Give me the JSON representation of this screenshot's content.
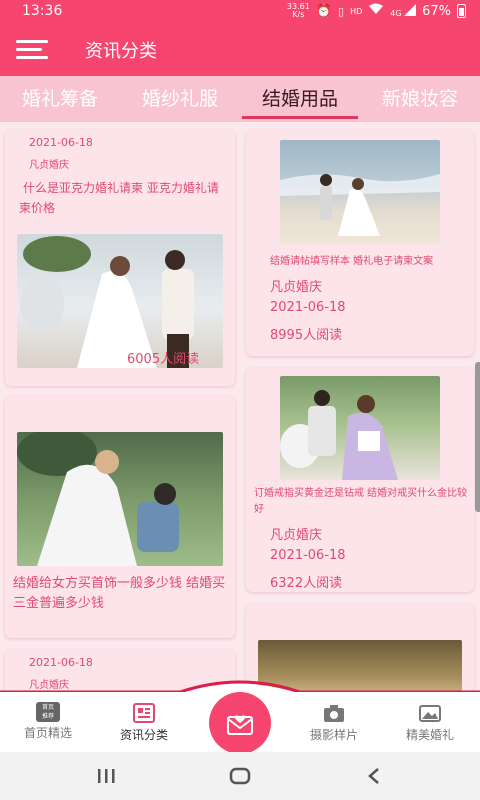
{
  "status_bar": {
    "time": "13:36",
    "net_speed_value": "33.61",
    "net_speed_unit": "K/s",
    "hd": "HD",
    "signal": "4G",
    "battery": "67%"
  },
  "header": {
    "title": "资讯分类"
  },
  "tabs": [
    {
      "label": "婚礼筹备",
      "active": false
    },
    {
      "label": "婚纱礼服",
      "active": false
    },
    {
      "label": "结婚用品",
      "active": true
    },
    {
      "label": "新娘妆容",
      "active": false
    }
  ],
  "cards": [
    {
      "date": "2021-06-18",
      "author": "凡贞婚庆",
      "title": "什么是亚克力婚礼请柬 亚克力婚礼请柬价格",
      "reads": "6005人阅读"
    },
    {
      "title": "结婚请帖填写样本 婚礼电子请柬文案",
      "author": "凡贞婚庆",
      "date": "2021-06-18",
      "reads": "8995人阅读"
    },
    {
      "title": "结婚给女方买首饰一般多少钱 结婚买三金普遍多少钱"
    },
    {
      "title": "订婚戒指买黄金还是钻戒 结婚对戒买什么金比较好",
      "author": "凡贞婚庆",
      "date": "2021-06-18",
      "reads": "6322人阅读"
    },
    {
      "date": "2021-06-18",
      "author": "凡贞婚庆"
    }
  ],
  "bottom_nav": [
    {
      "label": "首页精选",
      "icon": "home-featured-icon",
      "badge": "首页\n推荐"
    },
    {
      "label": "资讯分类",
      "icon": "news-category-icon",
      "badge": ""
    },
    {
      "label": "摄影样片",
      "icon": "camera-icon",
      "badge": ""
    },
    {
      "label": "精美婚礼",
      "icon": "wedding-gallery-icon",
      "badge": ""
    }
  ],
  "center_button": {
    "icon": "envelope-heart-icon"
  },
  "colors": {
    "primary": "#f6456e",
    "tab_bar": "#f9c4d2",
    "card_bg": "#fde3ea",
    "text_pink": "#e14a71"
  }
}
